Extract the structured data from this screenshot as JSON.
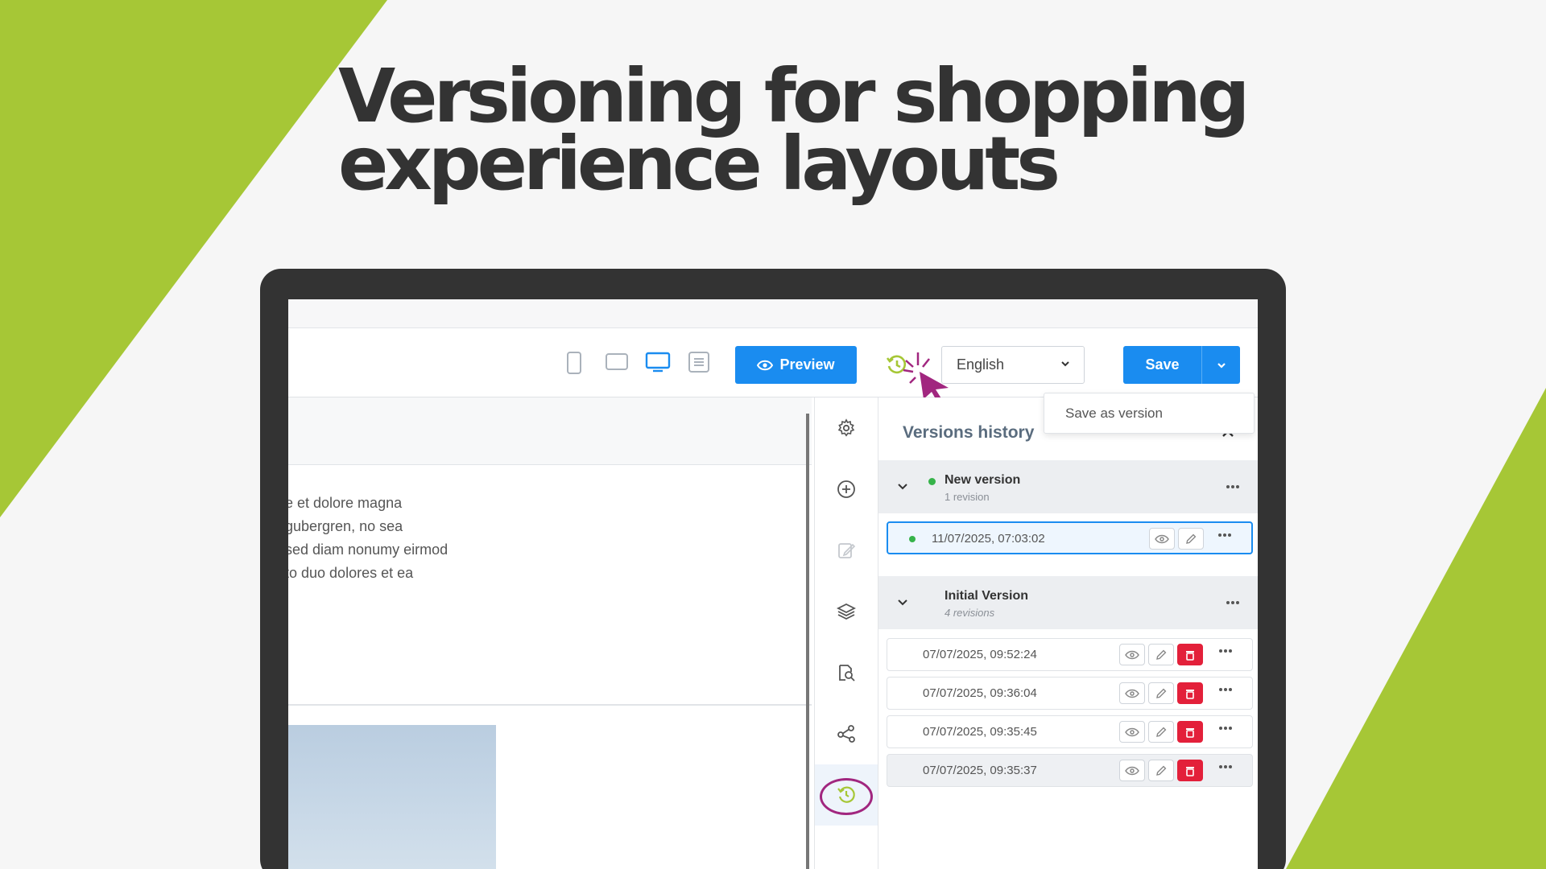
{
  "headline": "Versioning for shopping experience layouts",
  "colors": {
    "accent_green": "#a6c736",
    "primary_blue": "#1a8cf0",
    "danger_red": "#e3203a",
    "highlight_purple": "#a1267f",
    "status_green": "#36b34a"
  },
  "toolbar": {
    "device_icons": [
      "mobile-portrait-icon",
      "tablet-landscape-icon",
      "desktop-icon",
      "list-view-icon"
    ],
    "preview_label": "Preview",
    "language": "English",
    "save_label": "Save",
    "save_menu_item": "Save as version"
  },
  "canvas": {
    "text_lines": [
      "e et dolore magna",
      "gubergren, no sea",
      "sed diam nonumy eirmod",
      "to duo dolores et ea"
    ]
  },
  "rail": {
    "icons": [
      "settings-icon",
      "add-icon",
      "edit-icon",
      "layers-icon",
      "search-page-icon",
      "share-icon",
      "version-history-icon"
    ]
  },
  "versions_panel": {
    "title": "Versions history",
    "groups": [
      {
        "name": "New version",
        "revisions_label": "1 revision",
        "revisions": [
          {
            "timestamp": "11/07/2025, 07:03:02",
            "current": true
          }
        ]
      },
      {
        "name": "Initial Version",
        "revisions_label": "4 revisions",
        "revisions": [
          {
            "timestamp": "07/07/2025, 09:52:24"
          },
          {
            "timestamp": "07/07/2025, 09:36:04"
          },
          {
            "timestamp": "07/07/2025, 09:35:45"
          },
          {
            "timestamp": "07/07/2025, 09:35:37"
          }
        ]
      }
    ]
  }
}
